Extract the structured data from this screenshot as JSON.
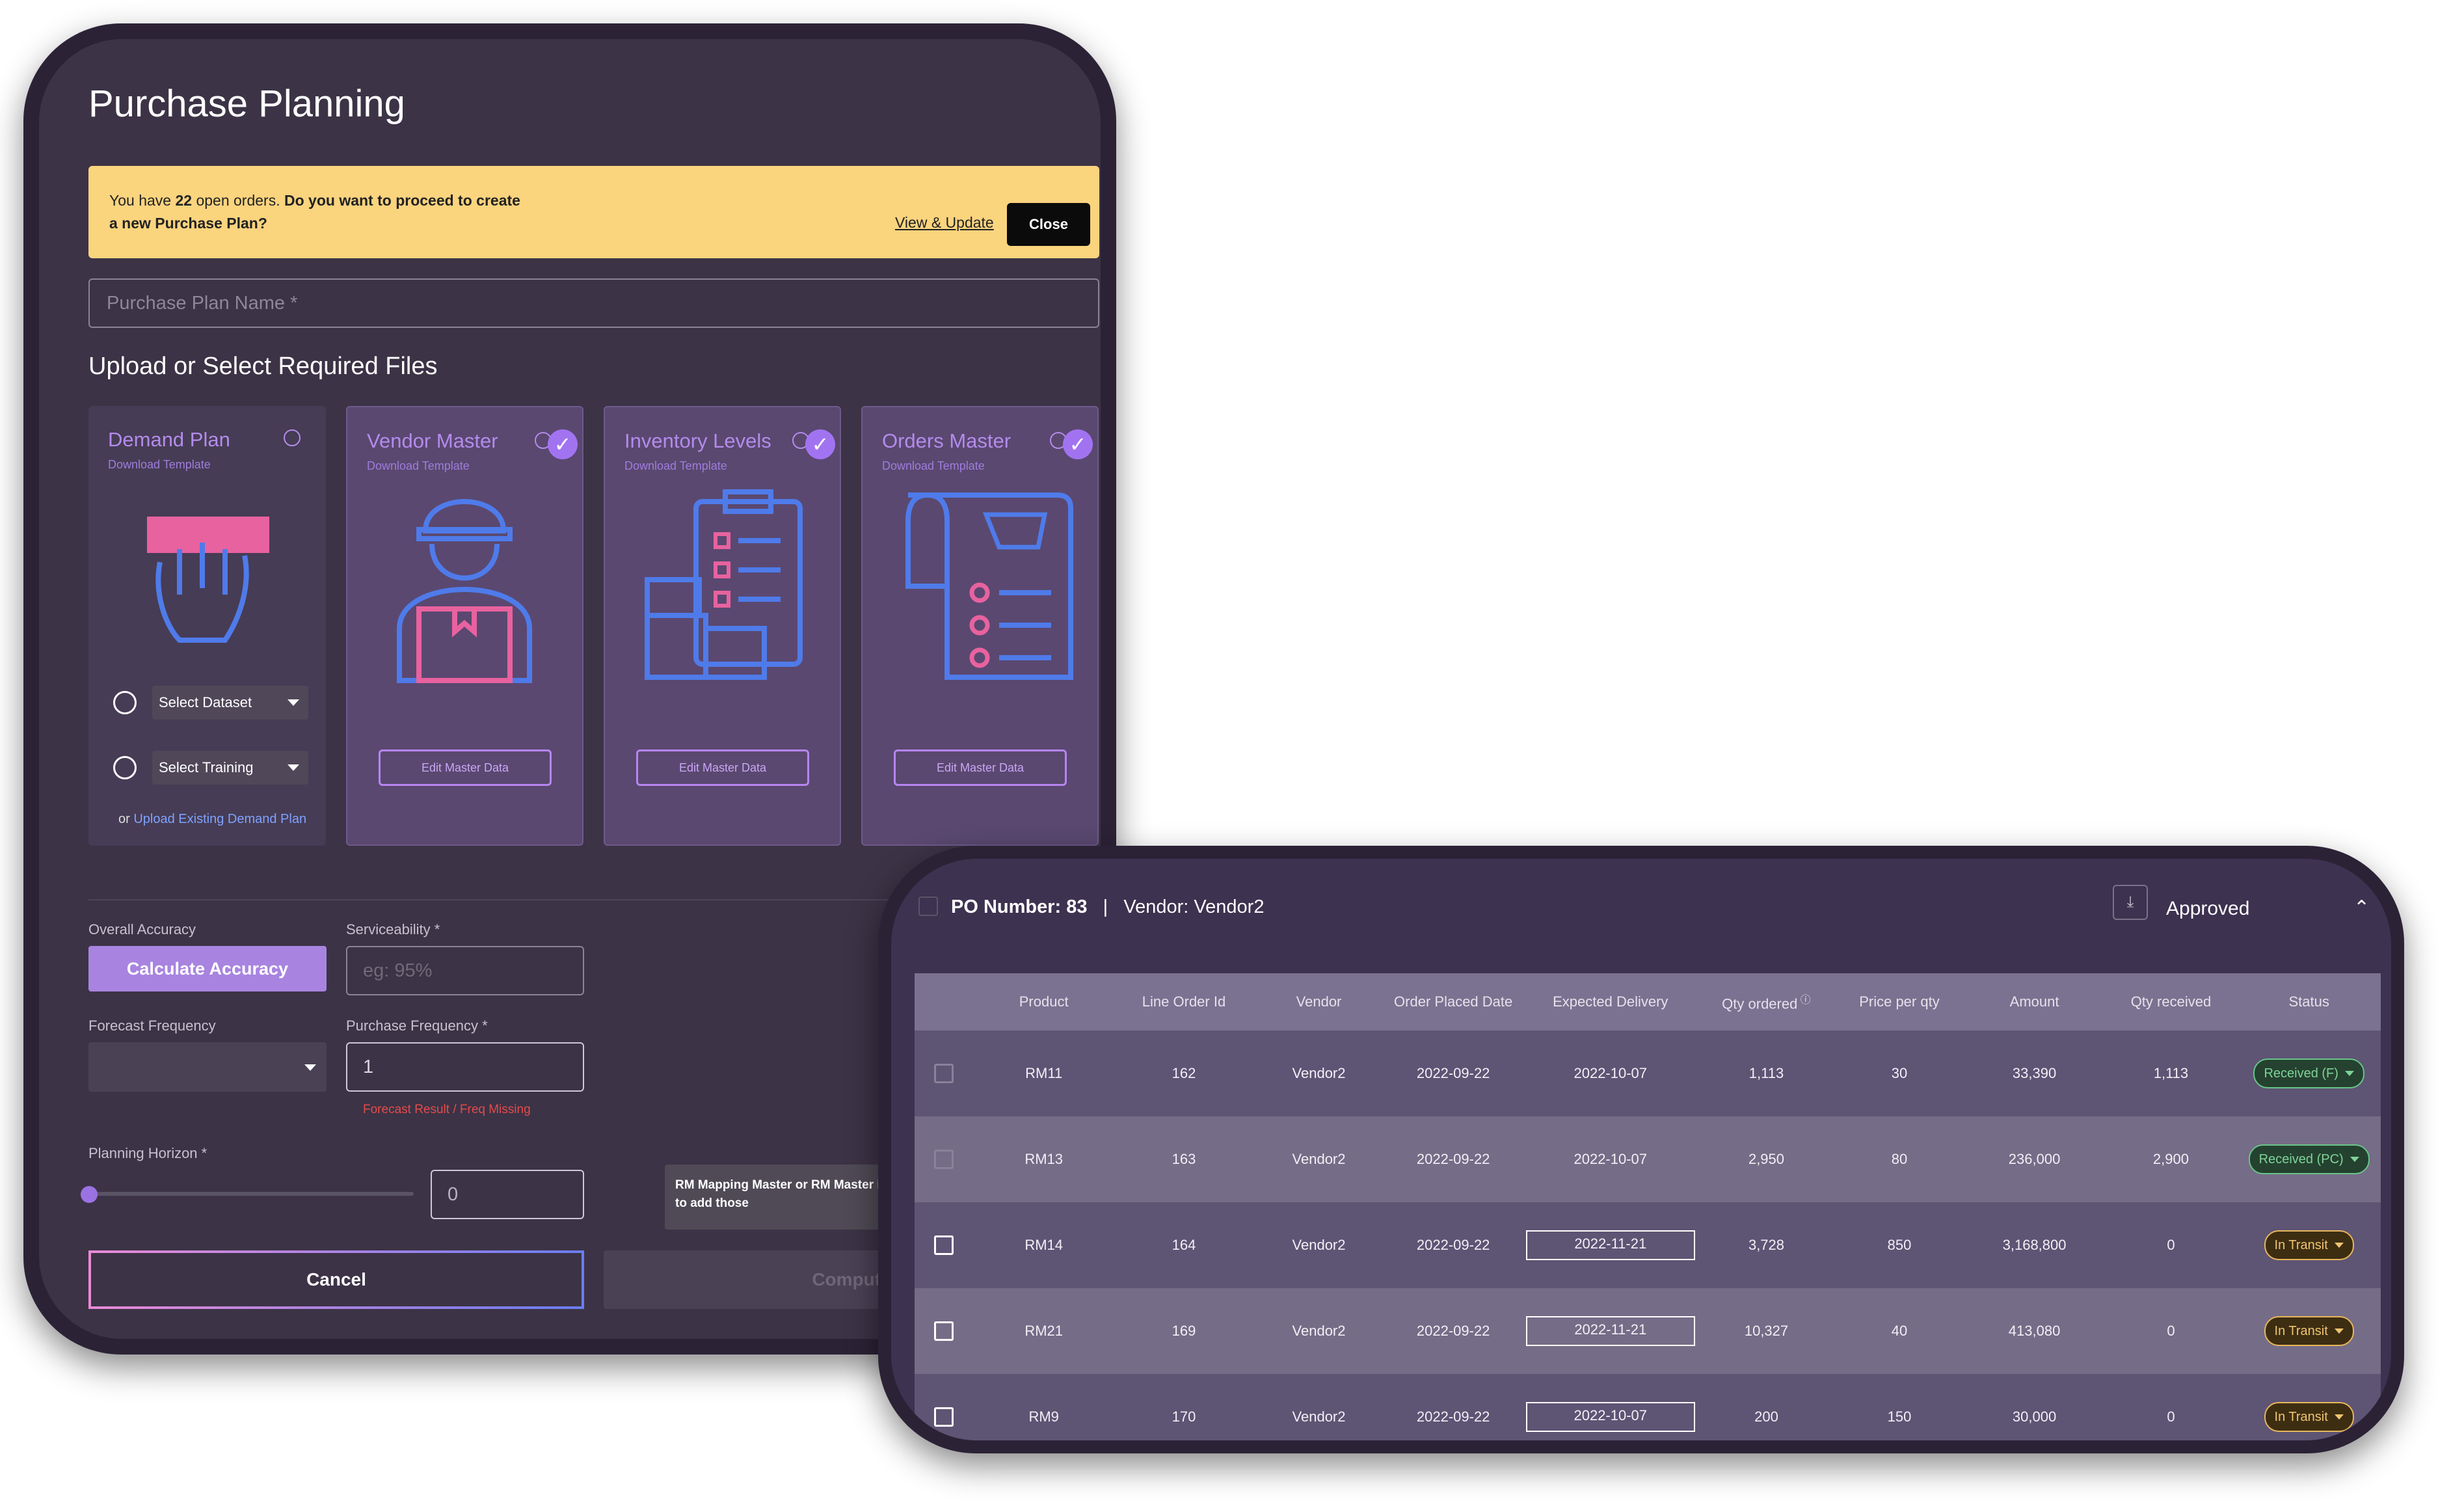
{
  "planning": {
    "title": "Purchase Planning",
    "banner": {
      "prefix": "You have ",
      "count": "22",
      "middle": " open orders. ",
      "question": "Do you want to proceed to create a new Purchase Plan?",
      "link": "View & Update",
      "close": "Close"
    },
    "plan_name_placeholder": "Purchase Plan Name *",
    "section_title": "Upload or Select Required Files",
    "cards": [
      {
        "title": "Demand Plan",
        "sub": "Download Template"
      },
      {
        "title": "Vendor Master",
        "sub": "Download Template",
        "edit": "Edit Master Data"
      },
      {
        "title": "Inventory Levels",
        "sub": "Download Template",
        "edit": "Edit Master Data"
      },
      {
        "title": "Orders Master",
        "sub": "Download Template",
        "edit": "Edit Master Data"
      }
    ],
    "demand": {
      "select_dataset": "Select Dataset",
      "select_training": "Select Training",
      "or": "or",
      "upload_link": "Upload Existing Demand Plan"
    },
    "form": {
      "overall_accuracy": "Overall Accuracy",
      "calc_btn": "Calculate Accuracy",
      "serviceability": "Serviceability *",
      "serviceability_placeholder": "eg: 95%",
      "forecast_freq": "Forecast Frequency",
      "purchase_freq": "Purchase Frequency *",
      "purchase_freq_value": "1",
      "error": "Forecast Result / Freq Missing",
      "planning_horizon": "Planning Horizon *",
      "horizon_value": "0",
      "tooltip": "RM Mapping Master or RM Master is not to add those",
      "cancel": "Cancel",
      "compute": "Compute"
    },
    "colors": {
      "banner": "#fbd47e",
      "accent": "#a884e0",
      "error": "#e34b4b"
    }
  },
  "po": {
    "number_label": "PO Number: 83",
    "separator": "|",
    "vendor_label": "Vendor: Vendor2",
    "status": "Approved",
    "columns": [
      "Product",
      "Line Order Id",
      "Vendor",
      "Order Placed Date",
      "Expected Delivery",
      "Qty ordered",
      "Price per qty",
      "Amount",
      "Qty received",
      "Status"
    ],
    "rows": [
      {
        "product": "RM11",
        "line": "162",
        "vendor": "Vendor2",
        "placed": "2022-09-22",
        "expected": "2022-10-07",
        "qty": "1,113",
        "price": "30",
        "amount": "33,390",
        "received": "1,113",
        "status": "Received (F)",
        "tone": "green",
        "editable_date": false
      },
      {
        "product": "RM13",
        "line": "163",
        "vendor": "Vendor2",
        "placed": "2022-09-22",
        "expected": "2022-10-07",
        "qty": "2,950",
        "price": "80",
        "amount": "236,000",
        "received": "2,900",
        "status": "Received (PC)",
        "tone": "green",
        "editable_date": false
      },
      {
        "product": "RM14",
        "line": "164",
        "vendor": "Vendor2",
        "placed": "2022-09-22",
        "expected": "2022-11-21",
        "qty": "3,728",
        "price": "850",
        "amount": "3,168,800",
        "received": "0",
        "status": "In Transit",
        "tone": "amber",
        "editable_date": true
      },
      {
        "product": "RM21",
        "line": "169",
        "vendor": "Vendor2",
        "placed": "2022-09-22",
        "expected": "2022-11-21",
        "qty": "10,327",
        "price": "40",
        "amount": "413,080",
        "received": "0",
        "status": "In Transit",
        "tone": "amber",
        "editable_date": true
      },
      {
        "product": "RM9",
        "line": "170",
        "vendor": "Vendor2",
        "placed": "2022-09-22",
        "expected": "2022-10-07",
        "qty": "200",
        "price": "150",
        "amount": "30,000",
        "received": "0",
        "status": "In Transit",
        "tone": "amber",
        "editable_date": true
      }
    ]
  }
}
